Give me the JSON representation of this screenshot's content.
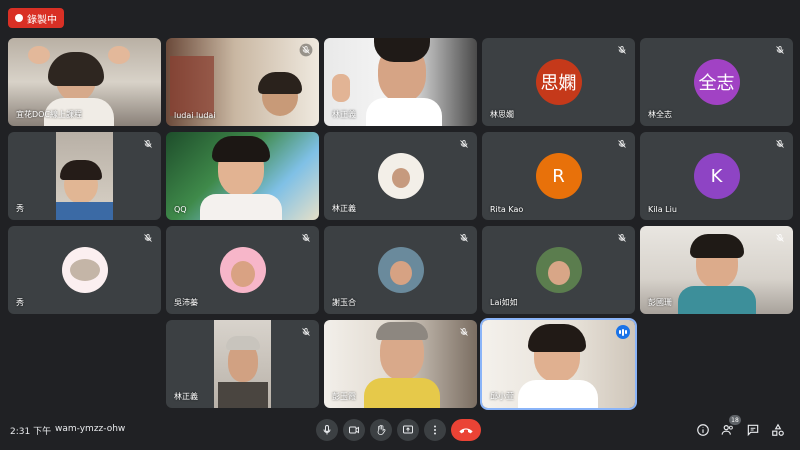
{
  "recording": {
    "label": "錄製中"
  },
  "tiles": [
    {
      "name": "宜花DOC線上課程"
    },
    {
      "name": "ludai ludai"
    },
    {
      "name": "林正義"
    },
    {
      "name": "林思嫺",
      "avatar_text": "思嫻",
      "avatar_color": "#c5391a"
    },
    {
      "name": "林全志",
      "avatar_text": "全志",
      "avatar_color": "#a142c4"
    },
    {
      "name": "秀"
    },
    {
      "name": "QQ"
    },
    {
      "name": "林正義"
    },
    {
      "name": "Rita Kao",
      "avatar_text": "R",
      "avatar_color": "#e8710a"
    },
    {
      "name": "Kila Liu",
      "avatar_text": "K",
      "avatar_color": "#8e44c4"
    },
    {
      "name": "秀"
    },
    {
      "name": "吳沛蓁"
    },
    {
      "name": "謝玉合"
    },
    {
      "name": "Lai如如"
    },
    {
      "name": "彭國珊"
    },
    {
      "name": "林正義"
    },
    {
      "name": "彭玉霞"
    },
    {
      "name": "邱小萱"
    }
  ],
  "footer": {
    "time": "2:31 下午",
    "meeting_code": "wam-ymzz-ohw",
    "participants_count": "18"
  },
  "controls": {
    "mic_icon": "mic-icon",
    "camera_icon": "camera-icon",
    "raise_hand_icon": "raise-hand-icon",
    "present_icon": "present-icon",
    "more_icon": "more-vert-icon",
    "hangup_icon": "call-end-icon"
  }
}
